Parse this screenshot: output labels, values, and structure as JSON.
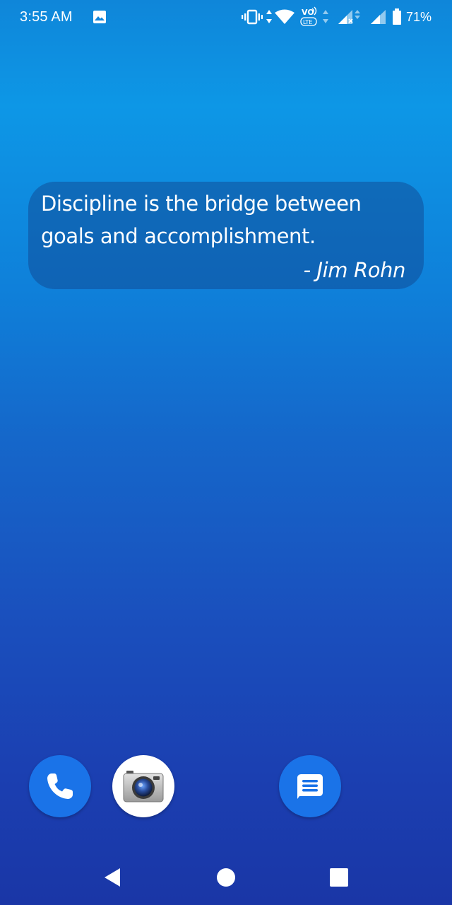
{
  "status_bar": {
    "time": "3:55 AM",
    "battery_percent": "71%",
    "network_badge_top": "VO",
    "network_badge_bottom": "LTE",
    "icons": [
      "gallery-notification-icon",
      "vibrate-icon",
      "wifi-icon",
      "volte-icon",
      "signal-sim1-icon",
      "signal-sim2-icon",
      "battery-icon"
    ]
  },
  "quote_widget": {
    "text": "Discipline is the bridge between goals and accomplishment.",
    "author": "- Jim Rohn"
  },
  "dock": {
    "apps": [
      {
        "name": "phone-app",
        "icon": "phone-icon",
        "color": "#1a73e8"
      },
      {
        "name": "camera-app",
        "icon": "camera-icon",
        "color": "#ffffff"
      },
      {
        "name": "messages-app",
        "icon": "messages-icon",
        "color": "#1a73e8"
      }
    ]
  },
  "nav_bar": {
    "buttons": [
      "back-icon",
      "home-icon",
      "recents-icon"
    ]
  },
  "colors": {
    "wallpaper_top": "#0f86d9",
    "wallpaper_bottom": "#1a36a6",
    "accent_blue": "#1a73e8"
  }
}
